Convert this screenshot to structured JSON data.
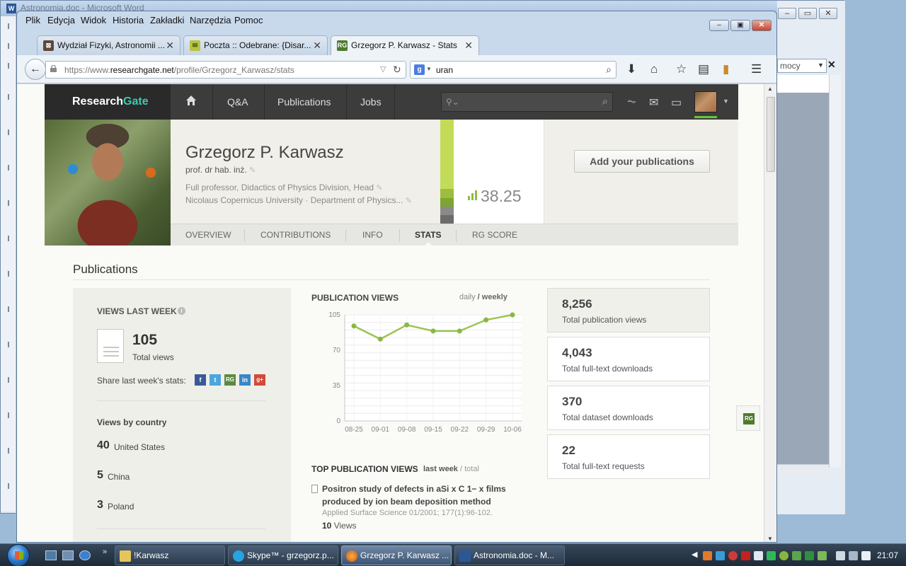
{
  "background_window": {
    "title": "Astronomia.doc - Microsoft Word",
    "combo_value": "mocy"
  },
  "browser": {
    "menu": [
      "Plik",
      "Edycja",
      "Widok",
      "Historia",
      "Zakładki",
      "Narzędzia",
      "Pomoc"
    ],
    "tabs": [
      {
        "label": "Wydział Fizyki, Astronomii ...",
        "icon": "book-icon",
        "active": false
      },
      {
        "label": "Poczta :: Odebrane: {Disar...",
        "icon": "mail-icon",
        "active": false
      },
      {
        "label": "Grzegorz P. Karwasz - Stats",
        "icon": "rg-icon",
        "active": true
      }
    ],
    "new_tab": "+",
    "url": {
      "prefix": "https://www.",
      "domain": "researchgate.net",
      "path": "/profile/Grzegorz_Karwasz/stats"
    },
    "search": {
      "value": "uran",
      "engine_icon": "google-icon"
    }
  },
  "rg": {
    "logo_a": "Research",
    "logo_b": "Gate",
    "nav": {
      "qa": "Q&A",
      "publications": "Publications",
      "jobs": "Jobs"
    },
    "colors": {
      "score_green": "#c3dc57",
      "chart_line": "#9cc455",
      "logo_accent": "#3dcab1"
    }
  },
  "profile": {
    "name": "Grzegorz P. Karwasz",
    "degree": "prof. dr hab. inż.",
    "position": "Full professor, Didactics of Physics Division, Head",
    "affiliation": "Nicolaus Copernicus University · Department of Physics...",
    "rg_score": "38.25",
    "add_publications": "Add your publications",
    "tabs": [
      "OVERVIEW",
      "CONTRIBUTIONS",
      "INFO",
      "STATS",
      "RG SCORE"
    ],
    "active_tab": "STATS"
  },
  "stats": {
    "section_title": "Publications",
    "views_last_week": {
      "label": "VIEWS LAST WEEK",
      "value": "105",
      "sublabel": "Total views",
      "share_label": "Share last week's stats:",
      "share_icons": [
        "facebook-icon",
        "twitter-icon",
        "researchgate-icon",
        "linkedin-icon",
        "googleplus-icon"
      ]
    },
    "views_by_country": {
      "label": "Views by country",
      "items": [
        {
          "count": "40",
          "country": "United States"
        },
        {
          "count": "5",
          "country": "China"
        },
        {
          "count": "3",
          "country": "Poland"
        }
      ]
    },
    "chart_header": {
      "title": "PUBLICATION VIEWS",
      "toggle_inactive": "daily",
      "sep": " / ",
      "toggle_active": "weekly"
    },
    "top_views": {
      "title": "TOP PUBLICATION VIEWS",
      "toggle_active": "last week",
      "sep": " / ",
      "toggle_inactive": "total",
      "publication": {
        "title": "Positron study of defects in aSi x C 1− x films produced by ion beam deposition method",
        "journal": "Applied Surface Science 01/2001; 177(1):96-102.",
        "views_count": "10",
        "views_label": "Views"
      }
    },
    "cards": [
      {
        "value": "8,256",
        "label": "Total publication views"
      },
      {
        "value": "4,043",
        "label": "Total full-text downloads"
      },
      {
        "value": "370",
        "label": "Total dataset downloads"
      },
      {
        "value": "22",
        "label": "Total full-text requests"
      }
    ]
  },
  "chart_data": {
    "type": "line",
    "x": [
      "08-25",
      "09-01",
      "09-08",
      "09-15",
      "09-22",
      "09-29",
      "10-06"
    ],
    "series": [
      {
        "values": [
          94,
          81,
          95,
          89,
          89,
          100,
          105
        ]
      }
    ],
    "yticks": [
      0,
      35,
      70,
      105
    ],
    "ylim": [
      0,
      105
    ],
    "grid": true
  },
  "taskbar": {
    "buttons": [
      {
        "label": "!Karwasz",
        "icon": "folder-icon",
        "active": false
      },
      {
        "label": "Skype™ - grzegorz.p...",
        "icon": "skype-icon",
        "active": false
      },
      {
        "label": "Grzegorz P. Karwasz ...",
        "icon": "firefox-icon",
        "active": true
      },
      {
        "label": "Astronomia.doc - M...",
        "icon": "word-icon",
        "active": false
      }
    ],
    "clock": "21:07"
  }
}
